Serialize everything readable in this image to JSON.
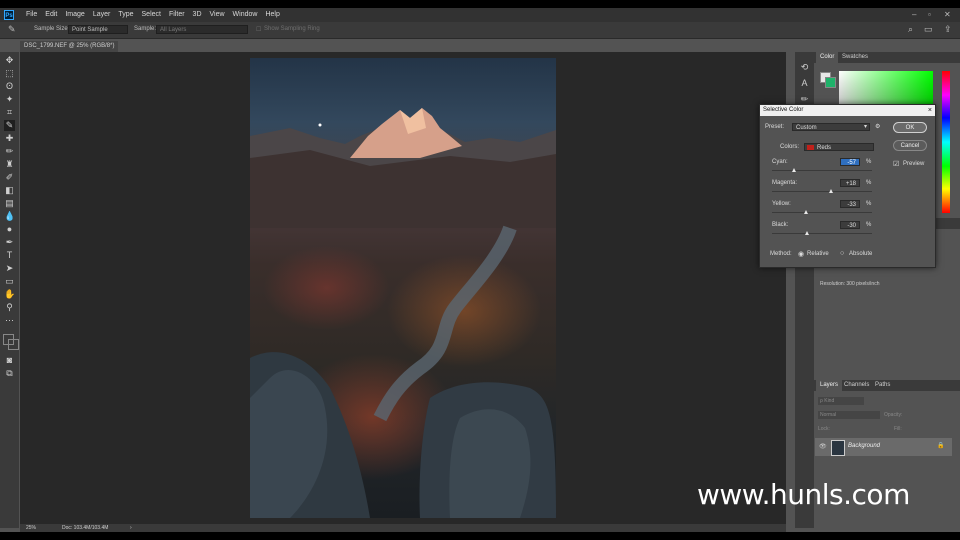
{
  "menubar": {
    "app_logo": "Ps",
    "items": [
      "File",
      "Edit",
      "Image",
      "Layer",
      "Type",
      "Select",
      "Filter",
      "3D",
      "View",
      "Window",
      "Help"
    ]
  },
  "options_bar": {
    "sample_size_label": "Sample Size:",
    "sample_size_value": "Point Sample",
    "sample_label": "Sample:",
    "sample_value": "All Layers",
    "show_ring_label": "Show Sampling Ring"
  },
  "document_tab": {
    "title": "DSC_1799.NEF @ 25% (RGB/8*)",
    "close": "×"
  },
  "status_bar": {
    "zoom": "25%",
    "doc_info": "Doc: 103.4M/103.4M",
    "arrow": "›"
  },
  "color_panel": {
    "tabs": [
      "Color",
      "Swatches"
    ]
  },
  "properties_panel": {
    "resolution": "Resolution: 300 pixels/inch"
  },
  "layers_panel": {
    "tabs": [
      "Layers",
      "Channels",
      "Paths"
    ],
    "kind_placeholder": "ρ Kind",
    "blend_mode": "Normal",
    "opacity_label": "Opacity:",
    "lock_label": "Lock:",
    "fill_label": "Fill:",
    "layer_name": "Background"
  },
  "dialog": {
    "title": "Selective Color",
    "close": "×",
    "preset_label": "Preset:",
    "preset_value": "Custom",
    "colors_label": "Colors:",
    "colors_value": "Reds",
    "colors_swatch": "#c0201a",
    "sliders": [
      {
        "label": "Cyan:",
        "value": "-57",
        "percent": -57,
        "selected": true
      },
      {
        "label": "Magenta:",
        "value": "+18",
        "percent": 18,
        "selected": false
      },
      {
        "label": "Yellow:",
        "value": "-33",
        "percent": -33,
        "selected": false
      },
      {
        "label": "Black:",
        "value": "-30",
        "percent": -30,
        "selected": false
      }
    ],
    "percent_sign": "%",
    "ok_label": "OK",
    "cancel_label": "Cancel",
    "preview_label": "Preview",
    "preview_checked": true,
    "method_label": "Method:",
    "method_options": [
      "Relative",
      "Absolute"
    ],
    "method_selected": "Relative"
  },
  "watermark": "www.hunls.com",
  "colors": {
    "foreground": "#e8e8e8",
    "background": "#1fb26a",
    "accent": "#31a8ff"
  }
}
